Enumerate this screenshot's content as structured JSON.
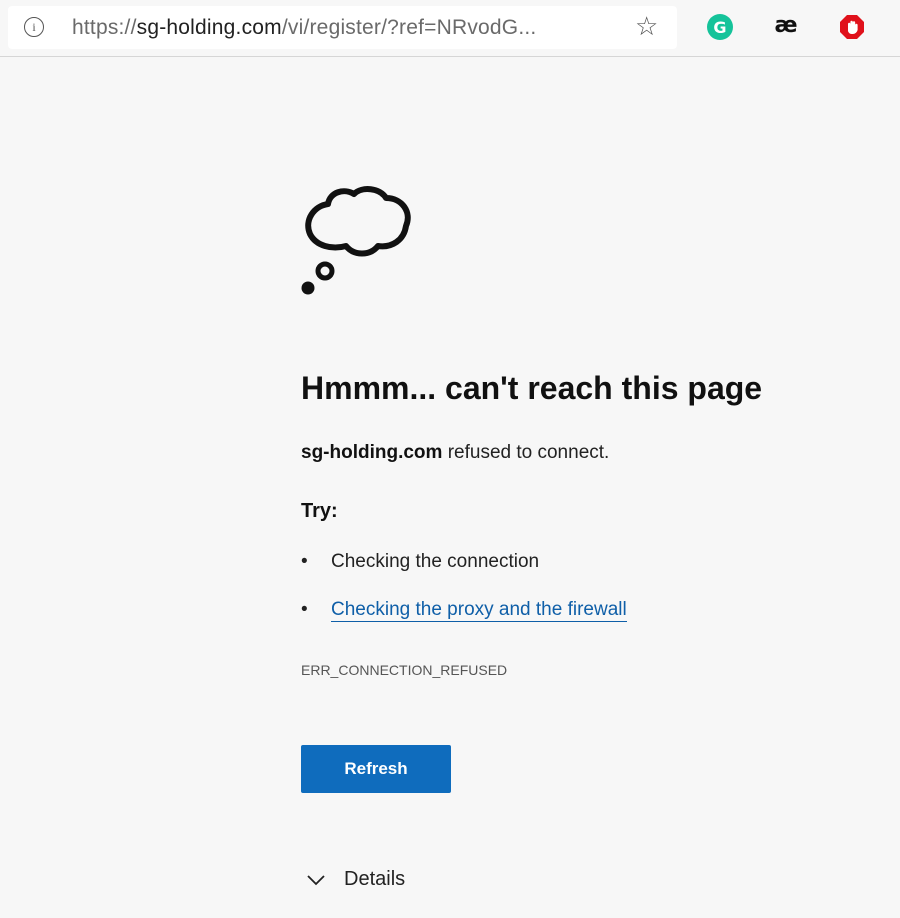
{
  "browser": {
    "url_scheme": "https://",
    "url_host": "sg-holding.com",
    "url_path": "/vi/register/?ref=NRvodG...",
    "extensions": [
      "grammarly-icon",
      "ae-icon",
      "adblock-stop-icon"
    ],
    "grammarly_letter": "G",
    "ae_label": "æ"
  },
  "error": {
    "title": "Hmmm... can't reach this page",
    "host": "sg-holding.com",
    "message": " refused to connect.",
    "try_label": "Try:",
    "suggestions": [
      "Checking the connection",
      "Checking the proxy and the firewall"
    ],
    "code": "ERR_CONNECTION_REFUSED",
    "refresh_label": "Refresh",
    "details_label": "Details"
  },
  "colors": {
    "accent": "#0f6cbd",
    "link": "#0f5fa8"
  }
}
